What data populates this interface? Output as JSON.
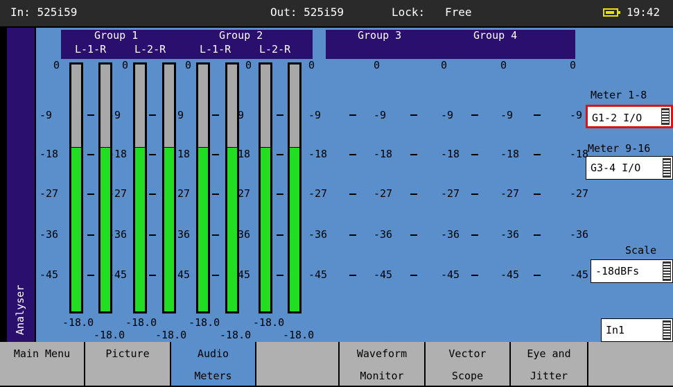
{
  "status": {
    "input": "In: 525i59",
    "output": "Out: 525i59",
    "lock_label": "Lock:",
    "lock_value": "Free",
    "time": "19:42"
  },
  "sidebar": {
    "label": "Analyser"
  },
  "groups": {
    "g1": "Group 1",
    "g2": "Group 2",
    "g3": "Group 3",
    "g4": "Group 4",
    "ch_l1r": "L-1-R",
    "ch_l2r": "L-2-R"
  },
  "scale_ticks": [
    "0",
    "-9",
    "-18",
    "-27",
    "-36",
    "-45"
  ],
  "meters": {
    "levels_dbfs": [
      -18.0,
      -18.0,
      -18.0,
      -18.0,
      -18.0,
      -18.0,
      -18.0,
      -18.0
    ],
    "readings_top": [
      "-18.0",
      "-18.0",
      "-18.0",
      "-18.0"
    ],
    "readings_bottom": [
      "-18.0",
      "-18.0",
      "-18.0",
      "-18.0"
    ]
  },
  "controls": {
    "meter_1_8_label": "Meter 1-8",
    "meter_1_8_value": "G1-2 I/O",
    "meter_9_16_label": "Meter 9-16",
    "meter_9_16_value": "G3-4 I/O",
    "scale_label": "Scale",
    "scale_value": "-18dBFs",
    "input_value": "In1"
  },
  "menu": {
    "main_menu": "Main Menu",
    "picture": "Picture",
    "audio_meters_1": "Audio",
    "audio_meters_2": "Meters",
    "waveform_1": "Waveform",
    "waveform_2": "Monitor",
    "vector_1": "Vector",
    "vector_2": "Scope",
    "eye_1": "Eye and",
    "eye_2": "Jitter"
  },
  "colors": {
    "accent_purple": "#2a0f6e",
    "panel_blue": "#5a8fcb",
    "meter_green": "#22dd22",
    "meter_gray": "#a8a8a8",
    "selected_border": "#e11010",
    "battery_yellow": "#e9e100"
  },
  "icons": {
    "battery": "battery-icon"
  }
}
